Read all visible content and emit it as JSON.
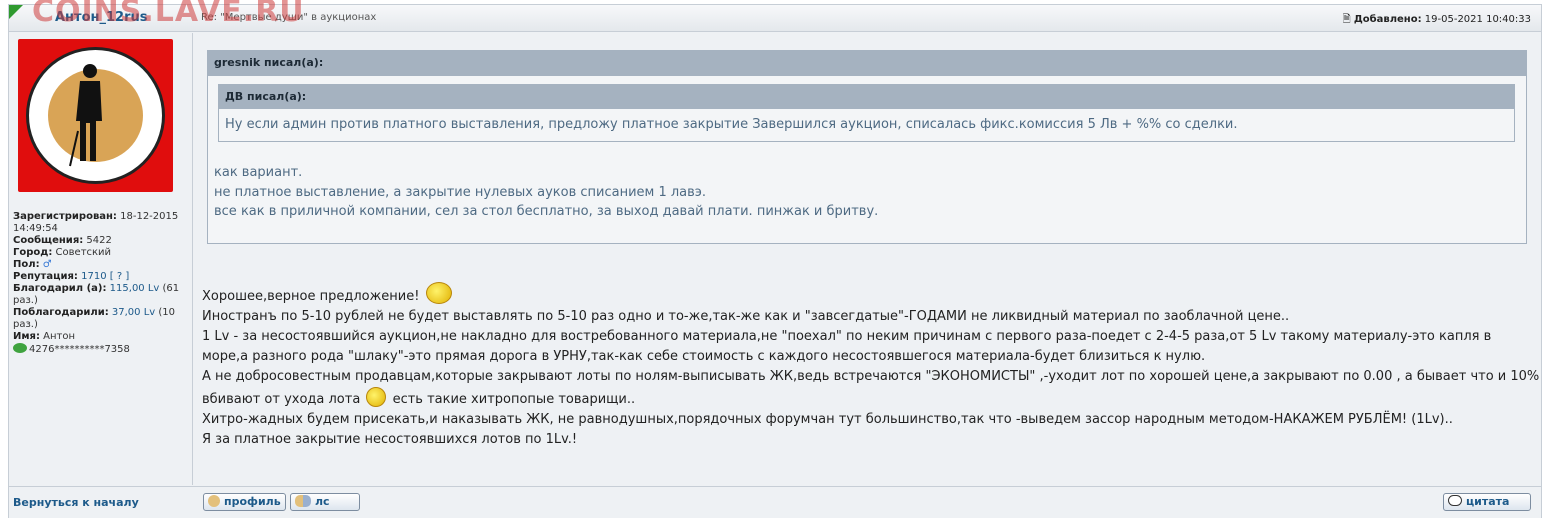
{
  "watermark": "COINS.LAVE.RU",
  "header": {
    "author": "Антон_12rus",
    "subject": "Re: \"Мертвые души\" в аукционах",
    "added_label": "Добавлено:",
    "added_value": "19-05-2021 10:40:33"
  },
  "profile": {
    "registered_label": "Зарегистрирован:",
    "registered_value": "18-12-2015 14:49:54",
    "messages_label": "Сообщения:",
    "messages_value": "5422",
    "city_label": "Город:",
    "city_value": "Советский",
    "gender_label": "Пол:",
    "gender_value": "♂",
    "reputation_label": "Репутация:",
    "reputation_value": "1710",
    "reputation_link": "[ ? ]",
    "thanked_label": "Благодарил (а):",
    "thanked_value": "115,00 Lv",
    "thanked_count": "(61 раз.)",
    "thanks_label": "Поблагодарили:",
    "thanks_value": "37,00 Lv",
    "thanks_count": "(10 раз.)",
    "name_label": "Имя:",
    "name_value": "Антон",
    "card_value": "4276**********7358"
  },
  "quote": {
    "author": "gresnik писал(а):",
    "inner_author": "ДВ писал(а):",
    "inner_text": "Ну если админ против платного выставления, предложу платное закрытие Завершился аукцион, списалась фикс.комиссия 5 Лв + %% со сделки.",
    "lines": [
      "как вариант.",
      "не платное выставление, а закрытие нулевых ауков списанием 1 лавэ.",
      "все как в приличной компании, сел за стол бесплатно, за выход давай плати. пинжак и бритву."
    ]
  },
  "message": {
    "line1": "Хорошее,верное предложение!",
    "line2": "Иностранъ по 5-10 рублей не будет выставлять по 5-10 раз одно и то-же,так-же как и \"завсегдатые\"-ГОДАМИ не ликвидный материал по заоблачной цене..",
    "line3": "1 Lv - за несостоявшийся аукцион,не накладно для востребованного материала,не \"поехал\" по неким причинам с первого раза-поедет с 2-4-5 раза,от 5 Lv такому материалу-это капля в море,а разного рода \"шлаку\"-это прямая дорога в УРНУ,так-как себе стоимость с каждого несостоявшегося материала-будет близиться к нулю.",
    "line4a": "А не добросовестным продавцам,которые закрывают лоты по нолям-выписывать ЖК,ведь встречаются \"ЭКОНОМИСТЫ\" ,-уходит лот по хорошей цене,а закрывают по 0.00 , а бывает что и 10% вбивают от ухода лота",
    "line4b": "есть такие хитропопые товарищи..",
    "line5": "Хитро-жадных будем присекать,и наказывать ЖК, не равнодушных,порядочных форумчан тут большинство,так что -выведем зассор народным методом-НАКАЖЕМ РУБЛЁМ! (1Lv)..",
    "line6": "Я за платное закрытие несостоявшихся лотов по 1Lv.!"
  },
  "footer": {
    "back": "Вернуться к началу",
    "profile": "профиль",
    "pm": "лс",
    "quote": "цитата"
  }
}
